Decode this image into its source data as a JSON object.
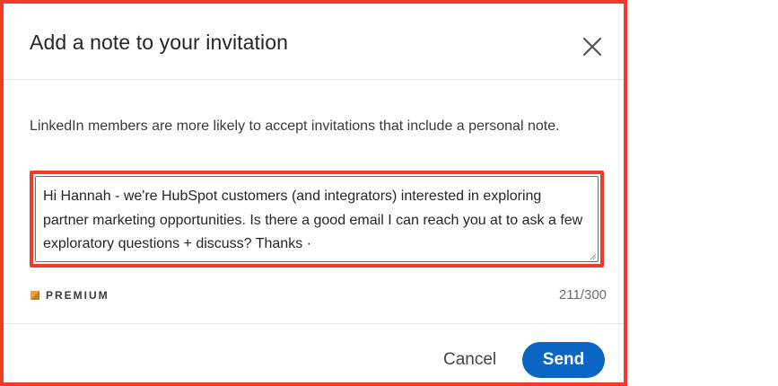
{
  "dialog": {
    "title": "Add a note to your invitation",
    "close_label": "close",
    "description": "LinkedIn members are more likely to accept invitations that include a personal note.",
    "note_text": "Hi Hannah - we're HubSpot customers (and integrators) interested in exploring partner marketing opportunities. Is there a good email I can reach you at to ask a few exploratory questions + discuss? Thanks ·",
    "premium_label": "PREMIUM",
    "char_count": "211/300",
    "cancel_label": "Cancel",
    "send_label": "Send"
  },
  "colors": {
    "accent": "#0a66c2",
    "highlight_border": "#f13a2c",
    "premium_gold": "#e7a33e"
  },
  "icons": {
    "close": "close-icon",
    "premium": "premium-badge-icon"
  }
}
